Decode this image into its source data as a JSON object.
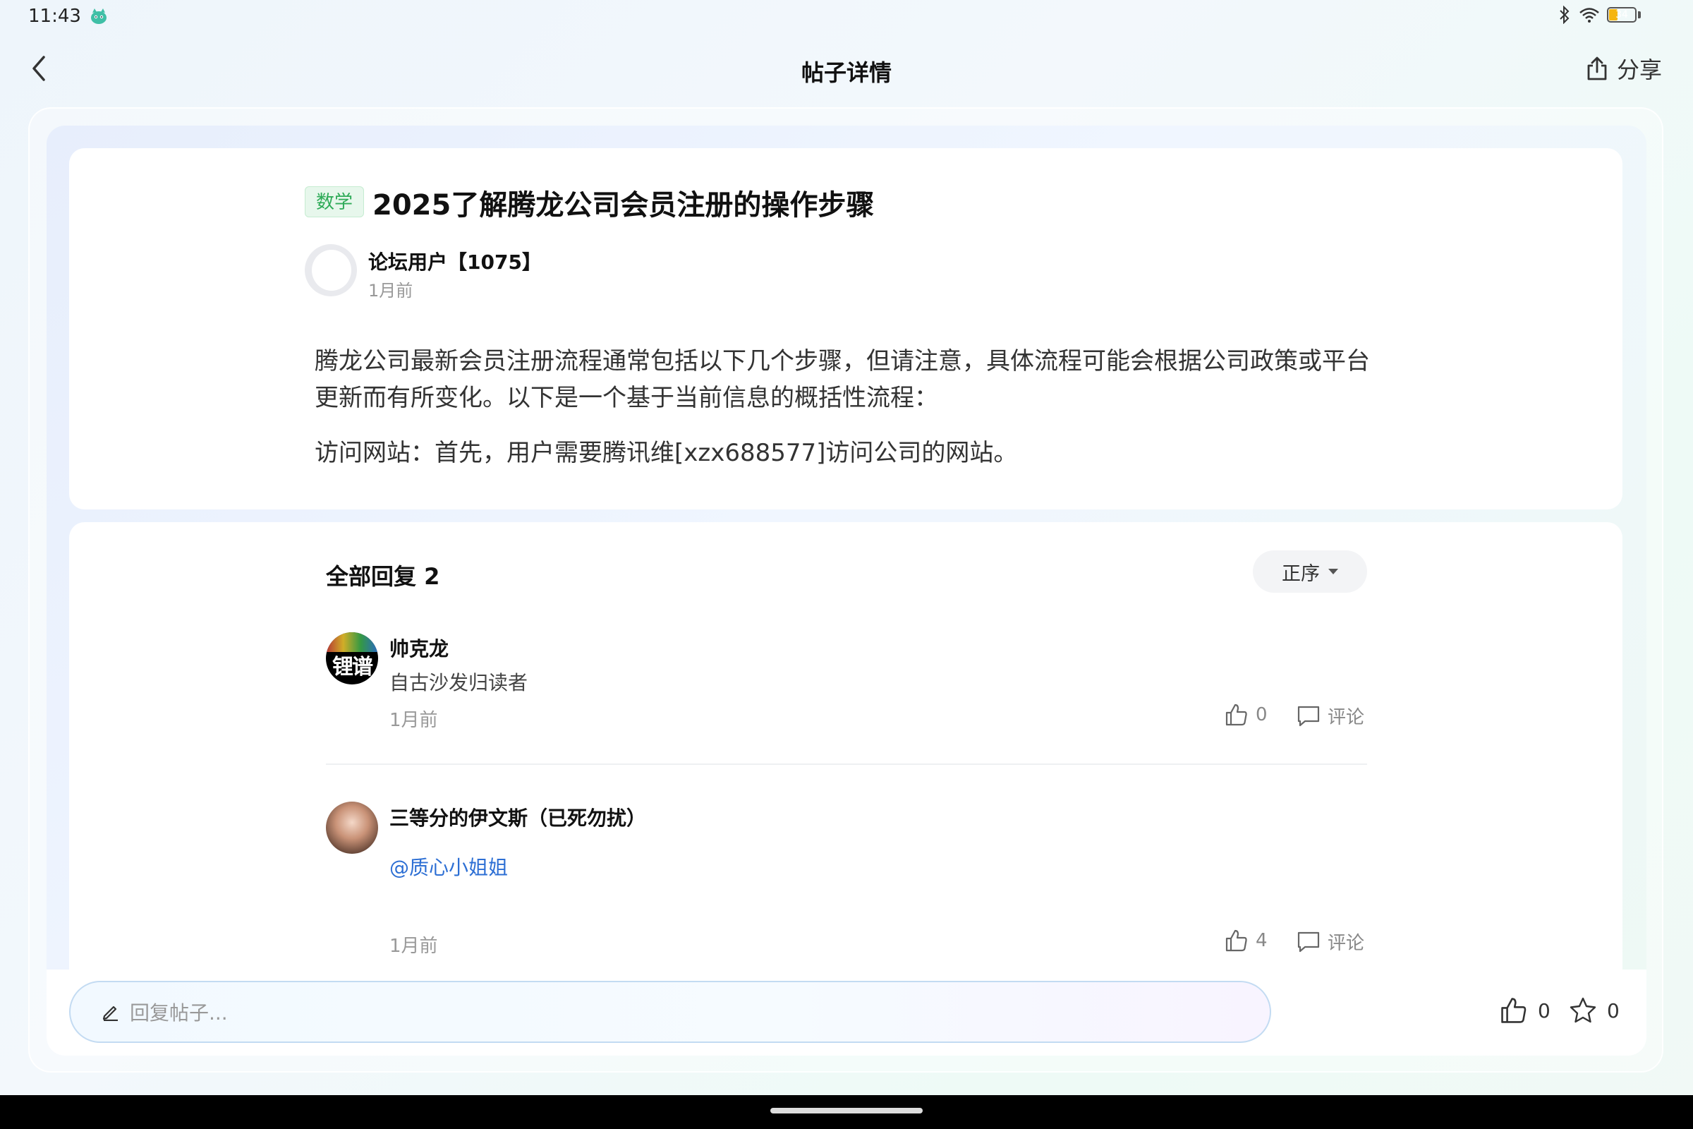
{
  "status_bar": {
    "time": "11:43",
    "battery_level": "34",
    "battery_fraction": 0.34
  },
  "header": {
    "title": "帖子详情",
    "share_label": "分享"
  },
  "post": {
    "tag": "数学",
    "title": "2025了解腾龙公司会员注册的操作步骤",
    "author": "论坛用户【1075】",
    "time": "1月前",
    "paragraphs": [
      "腾龙公司最新会员注册流程通常包括以下几个步骤，但请注意，具体流程可能会根据公司政策或平台更新而有所变化。以下是一个基于当前信息的概括性流程：",
      "访问网站：首先，用户需要腾讯维[xzx688577]访问公司的网站。"
    ]
  },
  "replies": {
    "header": "全部回复 2",
    "sort_label": "正序",
    "comment_label": "评论",
    "items": [
      {
        "avatar_text": "锂谱",
        "name": "帅克龙",
        "text": "自古沙发归读者",
        "time": "1月前",
        "likes": "0"
      },
      {
        "name": "三等分的伊文斯（已死勿扰）",
        "mention": "@质心小姐姐",
        "time": "1月前",
        "likes": "4"
      }
    ]
  },
  "reply_bar": {
    "placeholder": "回复帖子...",
    "likes": "0",
    "favorites": "0"
  },
  "colors": {
    "tag_green": "#2fab58",
    "link_blue": "#2d6fd4",
    "battery": "#f5b50f"
  }
}
